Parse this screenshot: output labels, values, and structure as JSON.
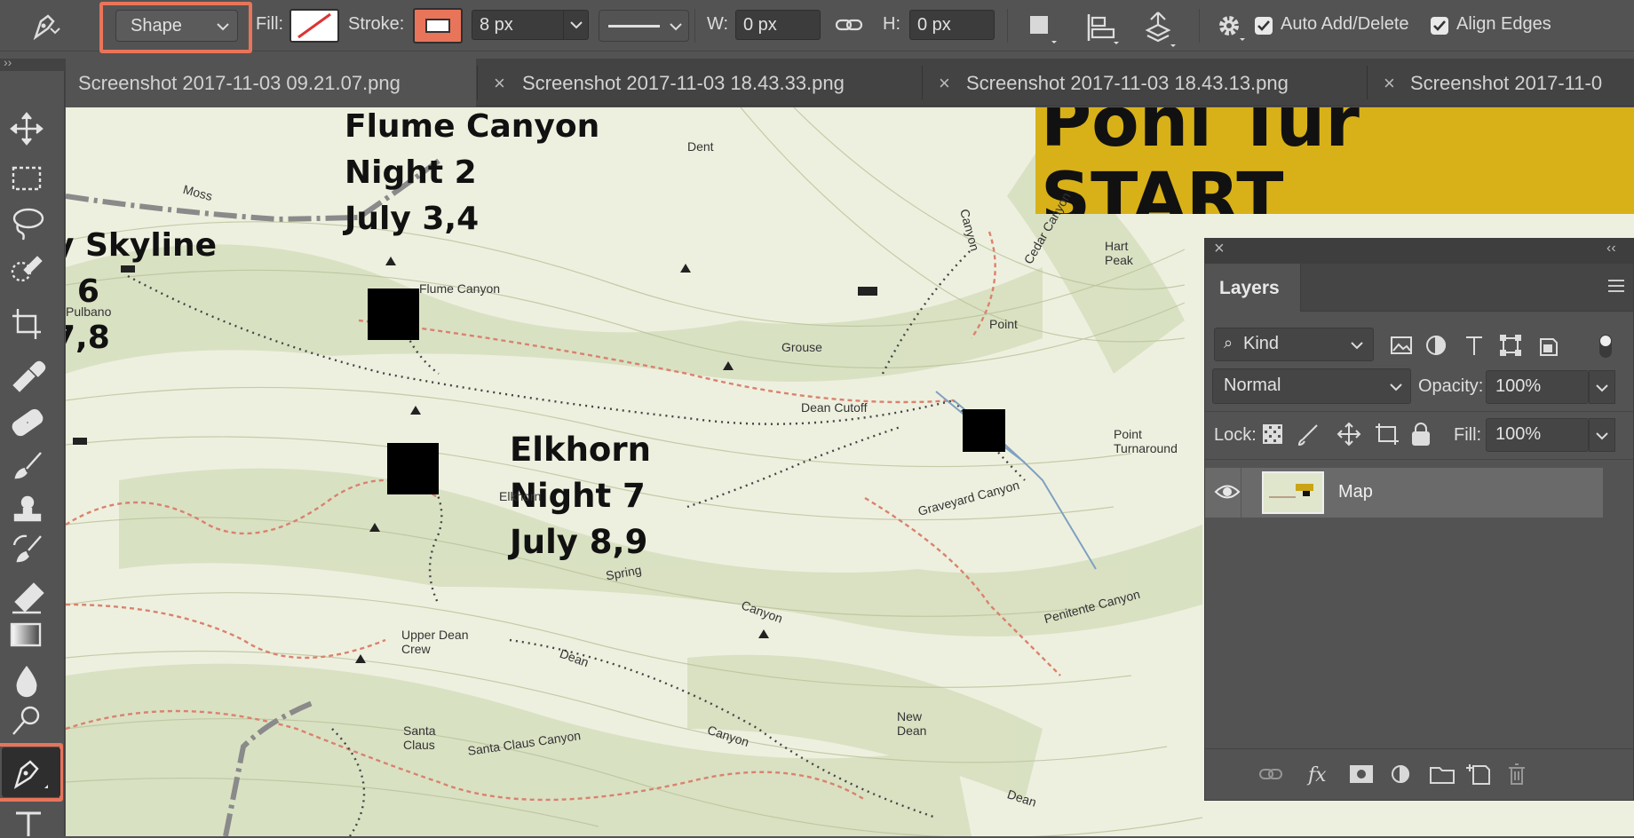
{
  "options_bar": {
    "tool_mode": "Shape",
    "fill_label": "Fill:",
    "stroke_label": "Stroke:",
    "stroke_width": "8 px",
    "width_label": "W:",
    "width_value": "0 px",
    "height_label": "H:",
    "height_value": "0 px",
    "auto_add_delete_label": "Auto Add/Delete",
    "auto_add_delete_checked": true,
    "align_edges_label": "Align Edges",
    "align_edges_checked": true,
    "accent_color": "#e8745a"
  },
  "tabs": [
    {
      "label": "Screenshot 2017-11-03 09.21.07.png",
      "active": true
    },
    {
      "label": "Screenshot 2017-11-03 18.43.33.png",
      "active": false
    },
    {
      "label": "Screenshot 2017-11-03 18.43.13.png",
      "active": false
    },
    {
      "label": "Screenshot 2017-11-0",
      "active": false
    }
  ],
  "tools": [
    "move-tool",
    "marquee-tool",
    "lasso-tool",
    "quick-selection-tool",
    "crop-tool",
    "eyedropper-tool",
    "healing-brush-tool",
    "brush-tool",
    "clone-stamp-tool",
    "history-brush-tool",
    "eraser-tool",
    "gradient-tool",
    "blur-tool",
    "dodge-tool",
    "pen-tool",
    "type-tool"
  ],
  "active_tool": "pen-tool",
  "map": {
    "labels": {
      "flume_name": "Flume Canyon",
      "flume_night": "Night 2",
      "flume_dates": "July 3,4",
      "skyline_name": "y Skyline",
      "skyline_night": ": 6",
      "skyline_dates": "7,8",
      "elkhorn_name": "Elkhorn",
      "elkhorn_night": "Night 7",
      "elkhorn_dates": "July 8,9",
      "banner_top": "Poni Tur",
      "banner_start": "START"
    },
    "small_labels": [
      "Moss",
      "Flume Canyon",
      "Pulbano",
      "Elkhorn",
      "Spring",
      "Canyon",
      "Upper Dean Crew",
      "Dean",
      "Dean Cutoff",
      "Grouse",
      "Point",
      "Hart Peak",
      "Canyon",
      "Cedar Canyon",
      "Point Turnaround",
      "Graveyard Canyon",
      "Penitente Canyon",
      "New Dean",
      "Santa Claus",
      "Santa Claus Canyon",
      "Canyon",
      "Dean",
      "Dent"
    ]
  },
  "layers_panel": {
    "title": "Layers",
    "filter_kind": "Kind",
    "blend_mode": "Normal",
    "opacity_label": "Opacity:",
    "opacity_value": "100%",
    "lock_label": "Lock:",
    "fill_label": "Fill:",
    "fill_value": "100%",
    "layers": [
      {
        "name": "Map",
        "visible": true,
        "selected": true
      }
    ]
  }
}
